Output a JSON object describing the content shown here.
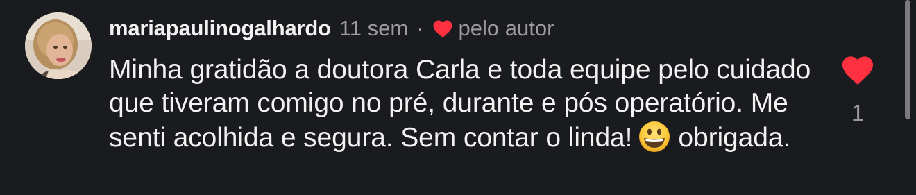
{
  "comment": {
    "username": "mariapaulinogalhardo",
    "time_ago": "11 sem",
    "separator": "·",
    "author_like_label": "pelo autor",
    "text_before_emoji": "Minha gratidão a doutora Carla e toda equipe pelo cuidado que tiveram comigo no pré, durante e pós operatório. Me senti acolhida e segura. Sem contar o linda!",
    "emoji": "grinning-face-emoji",
    "text_after_emoji": "obrigada.",
    "like_count": "1",
    "liked": true
  },
  "colors": {
    "background": "#1a1b1e",
    "primary_text": "#f2f2f2",
    "secondary_text": "#9a9a9f",
    "heart_red": "#ff3040"
  },
  "icons": {
    "avatar": "avatar",
    "author_heart": "heart-icon",
    "like_heart": "heart-icon"
  }
}
